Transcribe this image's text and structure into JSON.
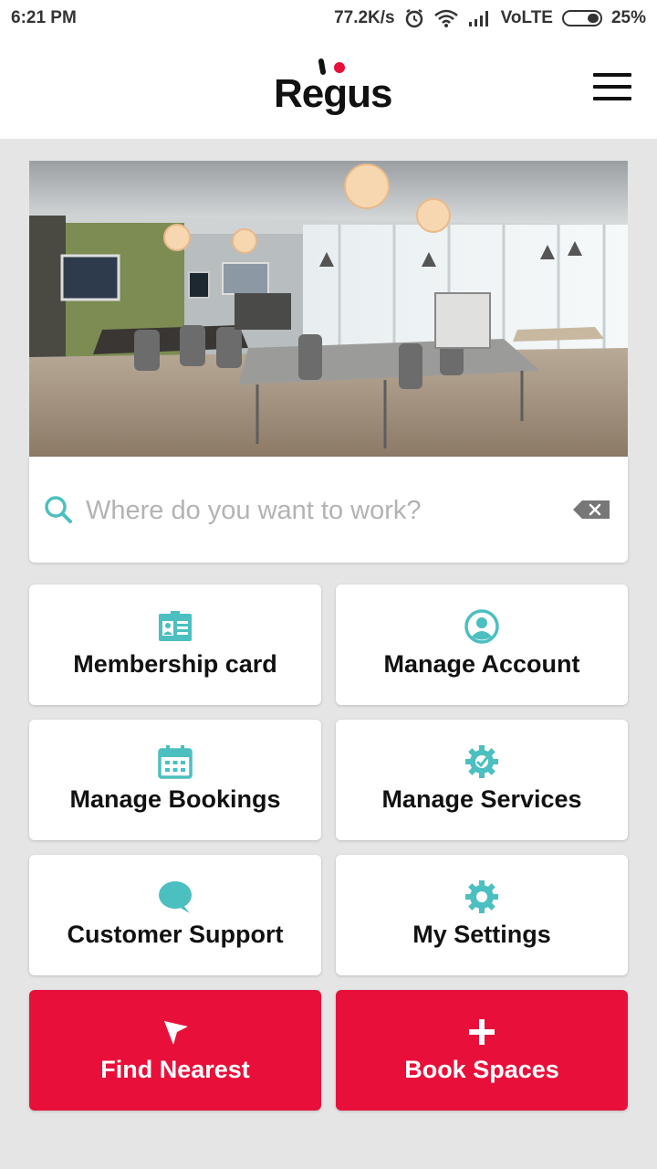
{
  "status_bar": {
    "time": "6:21 PM",
    "net_speed": "77.2K/s",
    "network": "VoLTE",
    "battery": "25%"
  },
  "header": {
    "logo_text": "Regus",
    "menu_icon": "hamburger-menu-icon"
  },
  "hero": {
    "image": "office-interior-photo"
  },
  "search": {
    "placeholder": "Where do you want to work?",
    "value": "",
    "icon": "search-icon",
    "clear_icon": "clear-input-icon"
  },
  "colors": {
    "accent": "#4cbfc0",
    "brand_red": "#e8103a",
    "background": "#e5e5e5"
  },
  "tiles": [
    {
      "label": "Membership card",
      "icon": "membership-card-icon"
    },
    {
      "label": "Manage Account",
      "icon": "account-icon"
    },
    {
      "label": "Manage Bookings",
      "icon": "calendar-icon"
    },
    {
      "label": "Manage Services",
      "icon": "services-gear-icon"
    },
    {
      "label": "Customer Support",
      "icon": "chat-bubble-icon"
    },
    {
      "label": "My Settings",
      "icon": "settings-gear-icon"
    }
  ],
  "actions": [
    {
      "label": "Find Nearest",
      "icon": "location-arrow-icon"
    },
    {
      "label": "Book Spaces",
      "icon": "plus-icon"
    }
  ]
}
